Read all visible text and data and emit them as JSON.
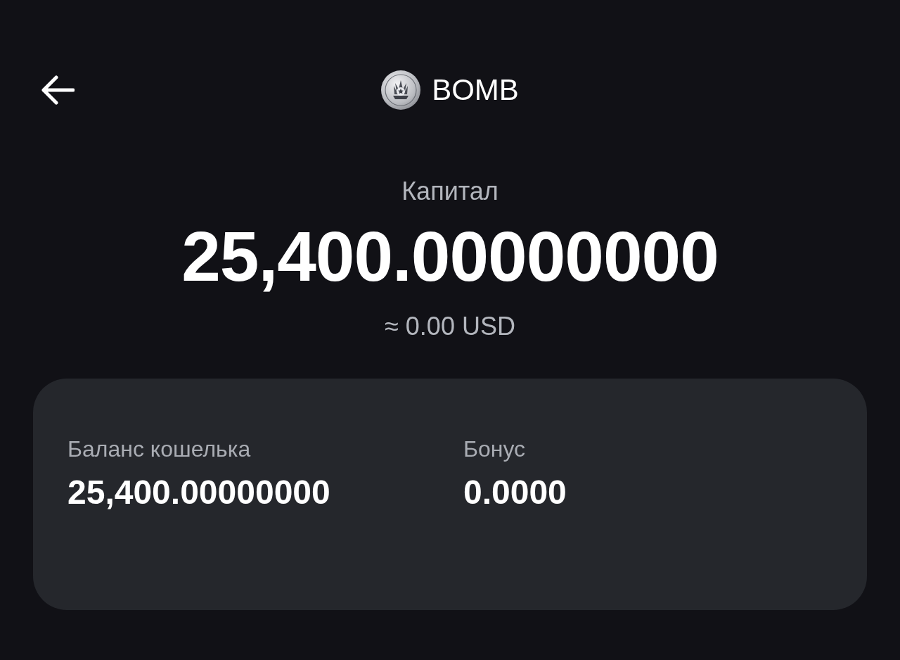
{
  "header": {
    "title": "BOMB"
  },
  "capital": {
    "label": "Капитал",
    "amount": "25,400.00000000",
    "usd_equivalent": "≈ 0.00 USD"
  },
  "balances": [
    {
      "label": "Баланс кошелька",
      "value": "25,400.00000000"
    },
    {
      "label": "Бонус",
      "value": "0.0000"
    }
  ]
}
